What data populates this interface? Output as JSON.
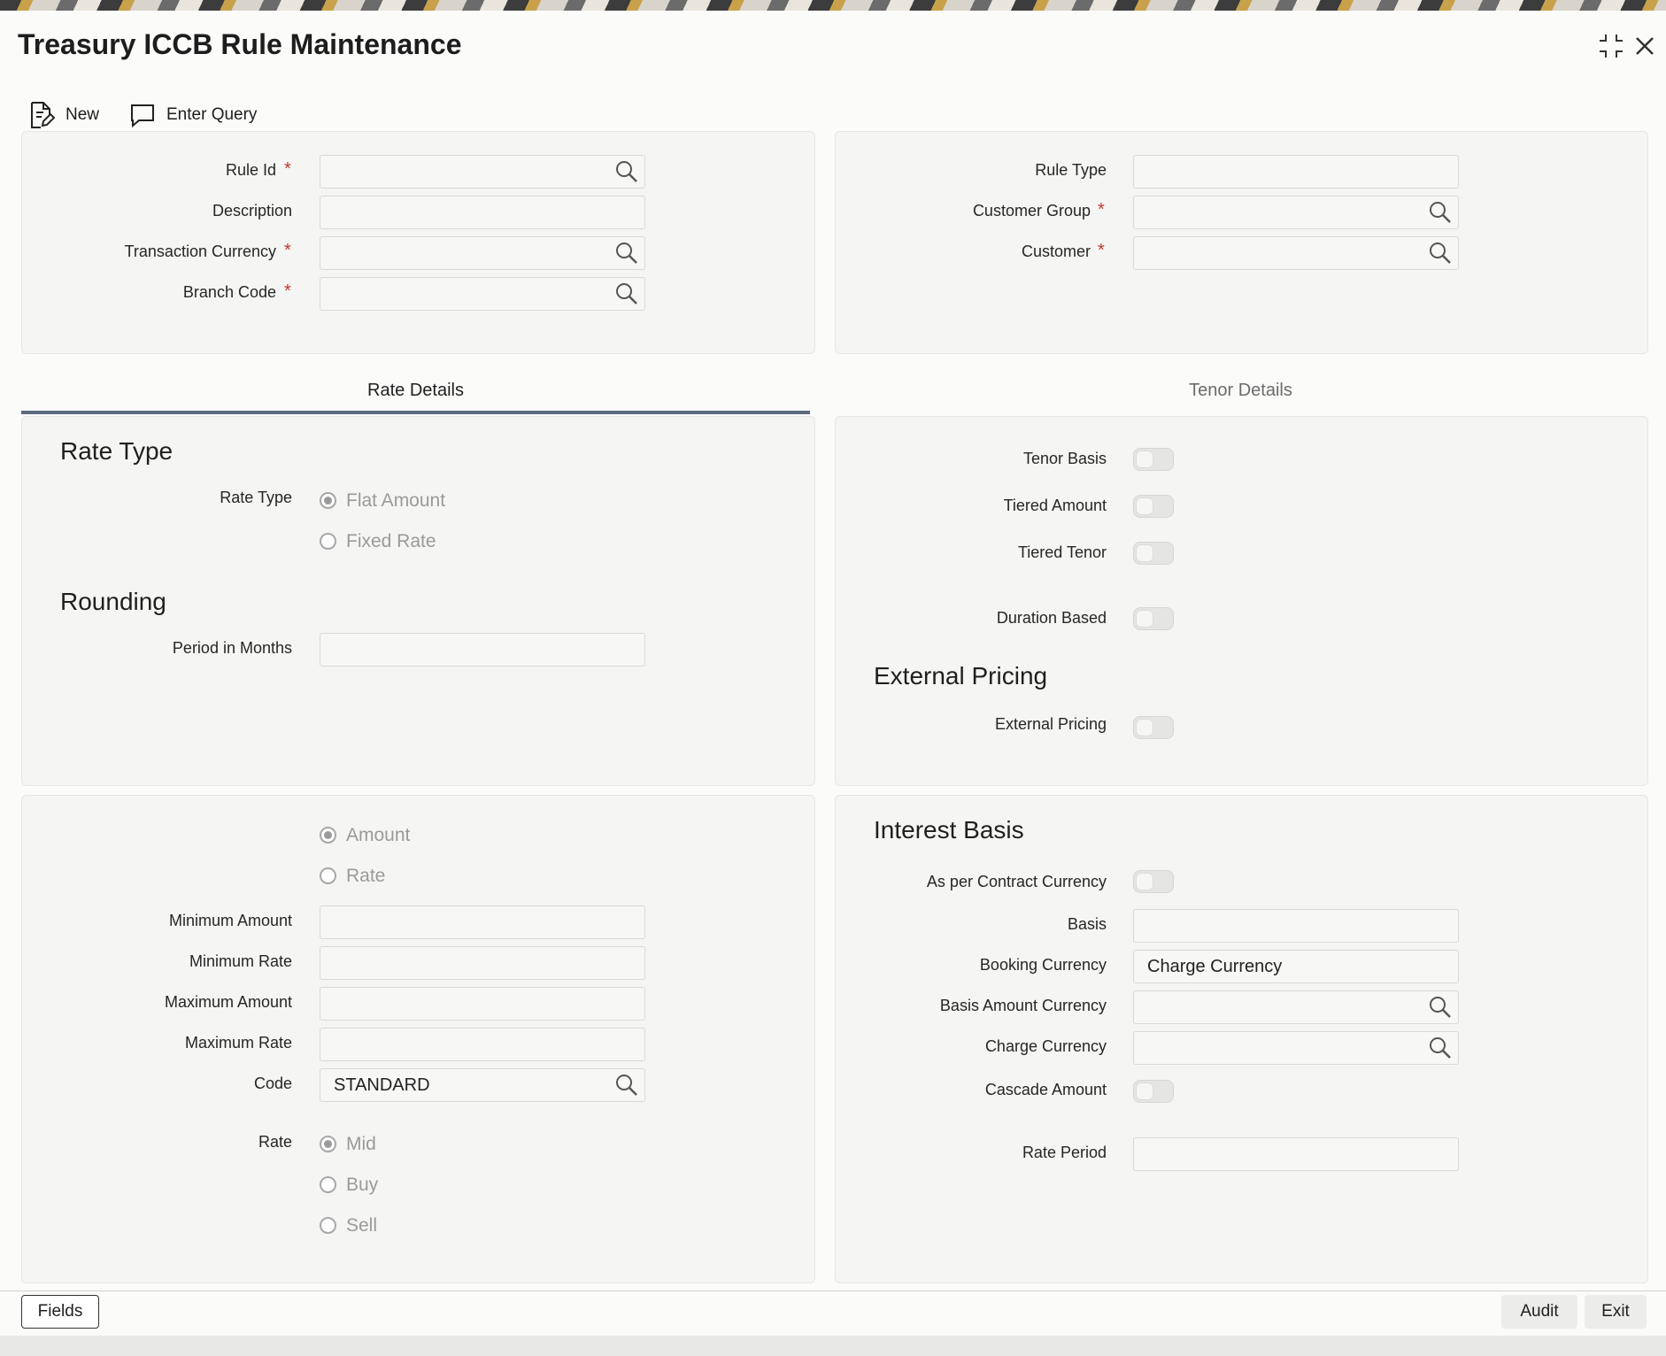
{
  "window": {
    "title": "Treasury ICCB Rule Maintenance"
  },
  "toolbar": {
    "new_label": "New",
    "enter_query_label": "Enter Query"
  },
  "header_left": {
    "rule_id_label": "Rule Id",
    "description_label": "Description",
    "transaction_currency_label": "Transaction Currency",
    "branch_code_label": "Branch Code"
  },
  "header_right": {
    "rule_type_label": "Rule Type",
    "customer_group_label": "Customer Group",
    "customer_label": "Customer"
  },
  "required_marker": "*",
  "tabs": {
    "rate_details": "Rate Details",
    "tenor_details": "Tenor Details"
  },
  "rate_details": {
    "rate_type_heading": "Rate Type",
    "rate_type_label": "Rate Type",
    "flat_amount": "Flat Amount",
    "fixed_rate": "Fixed Rate",
    "rounding_heading": "Rounding",
    "period_in_months_label": "Period in Months"
  },
  "tenor_details": {
    "tenor_basis_label": "Tenor Basis",
    "tiered_amount_label": "Tiered Amount",
    "tiered_tenor_label": "Tiered Tenor",
    "duration_based_label": "Duration Based",
    "external_pricing_heading": "External Pricing",
    "external_pricing_label": "External Pricing"
  },
  "amount_section": {
    "amount_option": "Amount",
    "rate_option": "Rate",
    "minimum_amount_label": "Minimum Amount",
    "minimum_rate_label": "Minimum Rate",
    "maximum_amount_label": "Maximum Amount",
    "maximum_rate_label": "Maximum Rate",
    "code_label": "Code",
    "code_value": "STANDARD",
    "rate_label": "Rate",
    "mid_option": "Mid",
    "buy_option": "Buy",
    "sell_option": "Sell"
  },
  "interest_basis": {
    "heading": "Interest Basis",
    "as_per_contract_currency_label": "As per Contract Currency",
    "basis_label": "Basis",
    "booking_currency_label": "Booking Currency",
    "booking_currency_value": "Charge Currency",
    "basis_amount_currency_label": "Basis Amount Currency",
    "charge_currency_label": "Charge Currency",
    "cascade_amount_label": "Cascade Amount",
    "rate_period_label": "Rate Period"
  },
  "footer": {
    "fields_label": "Fields",
    "audit_label": "Audit",
    "exit_label": "Exit"
  }
}
